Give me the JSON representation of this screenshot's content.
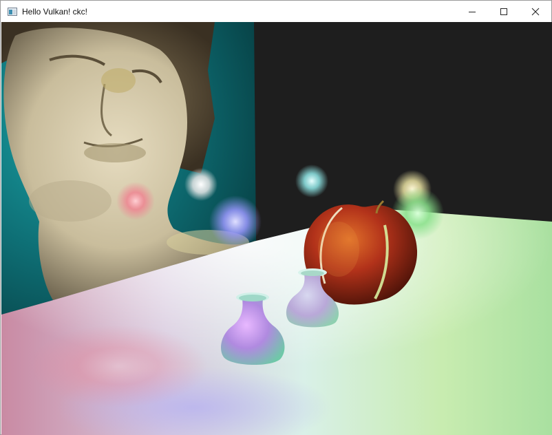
{
  "window": {
    "title": "Hello Vulkan! ckc!",
    "icon": "app-window-icon",
    "controls": [
      "minimize-icon",
      "maximize-icon",
      "close-icon"
    ]
  },
  "scene": {
    "background_color": "#1e1e1e",
    "wall_color": "#0e6e74",
    "objects": [
      "statue-texture-wall",
      "apple",
      "vase-large",
      "vase-small",
      "light-orbs",
      "floor"
    ]
  }
}
